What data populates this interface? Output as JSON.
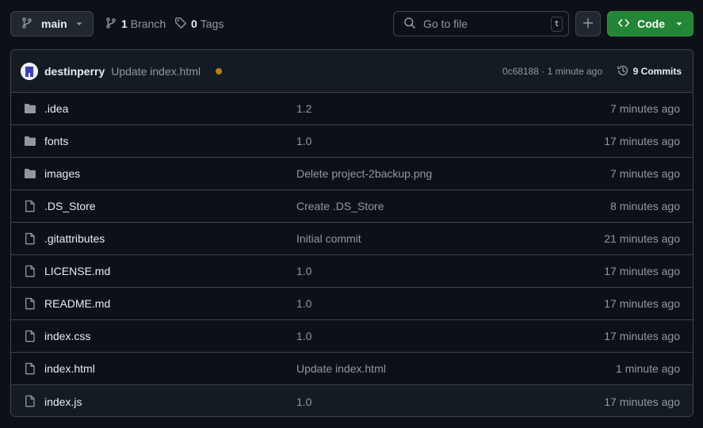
{
  "toolbar": {
    "branch_label": "main",
    "branches_count": "1",
    "branches_label": "Branch",
    "tags_count": "0",
    "tags_label": "Tags",
    "search_placeholder": "Go to file",
    "search_shortcut": "t",
    "code_label": "Code"
  },
  "commit": {
    "author": "destinperry",
    "message": "Update index.html",
    "status_color": "#bb8009",
    "meta": "0c68188 · 1 minute ago",
    "commits_count": "9 Commits"
  },
  "files": [
    {
      "type": "folder",
      "name": ".idea",
      "message": "1.2",
      "time": "7 minutes ago"
    },
    {
      "type": "folder",
      "name": "fonts",
      "message": "1.0",
      "time": "17 minutes ago"
    },
    {
      "type": "folder",
      "name": "images",
      "message": "Delete project-2backup.png",
      "time": "7 minutes ago"
    },
    {
      "type": "file",
      "name": ".DS_Store",
      "message": "Create .DS_Store",
      "time": "8 minutes ago"
    },
    {
      "type": "file",
      "name": ".gitattributes",
      "message": "Initial commit",
      "time": "21 minutes ago"
    },
    {
      "type": "file",
      "name": "LICENSE.md",
      "message": "1.0",
      "time": "17 minutes ago"
    },
    {
      "type": "file",
      "name": "README.md",
      "message": "1.0",
      "time": "17 minutes ago"
    },
    {
      "type": "file",
      "name": "index.css",
      "message": "1.0",
      "time": "17 minutes ago"
    },
    {
      "type": "file",
      "name": "index.html",
      "message": "Update index.html",
      "time": "1 minute ago"
    },
    {
      "type": "file",
      "name": "index.js",
      "message": "1.0",
      "time": "17 minutes ago"
    }
  ],
  "colors": {
    "background": "#0d1117",
    "accent_green": "#238636",
    "muted_text": "#9198a1"
  },
  "icons": {
    "branch": "git-branch-icon",
    "tag": "tag-icon",
    "search": "search-icon",
    "plus": "plus-icon",
    "code": "code-icon",
    "history": "history-icon",
    "folder": "folder-icon",
    "file": "file-icon"
  }
}
